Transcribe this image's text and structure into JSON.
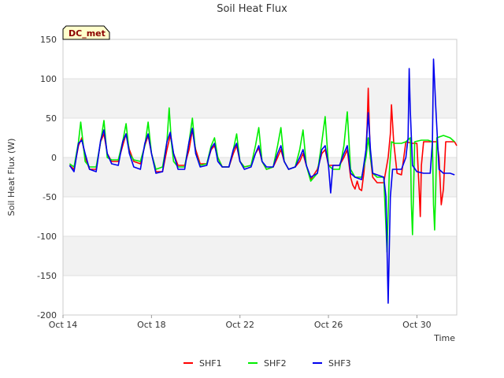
{
  "chart_data": {
    "type": "line",
    "title": "Soil Heat Flux",
    "xlabel": "Time",
    "ylabel": "Soil Heat Flux (W)",
    "badge": "DC_met",
    "xlim_days": [
      14,
      31.8
    ],
    "ylim": [
      -200,
      150
    ],
    "y_ticks": [
      -200,
      -150,
      -100,
      -50,
      0,
      50,
      100,
      150
    ],
    "x_ticks": [
      {
        "label": "Oct 14",
        "day": 14
      },
      {
        "label": "Oct 18",
        "day": 18
      },
      {
        "label": "Oct 22",
        "day": 22
      },
      {
        "label": "Oct 26",
        "day": 26
      },
      {
        "label": "Oct 30",
        "day": 30
      }
    ],
    "legend_position": "bottom-center",
    "series": [
      {
        "name": "SHF1",
        "color": "#ff0000",
        "points": [
          [
            14.3,
            -10
          ],
          [
            14.5,
            -15
          ],
          [
            14.7,
            15
          ],
          [
            14.85,
            25
          ],
          [
            15.0,
            0
          ],
          [
            15.2,
            -15
          ],
          [
            15.5,
            -15
          ],
          [
            15.7,
            20
          ],
          [
            15.85,
            30
          ],
          [
            16.0,
            5
          ],
          [
            16.2,
            -5
          ],
          [
            16.5,
            -5
          ],
          [
            16.7,
            15
          ],
          [
            16.85,
            30
          ],
          [
            17.0,
            10
          ],
          [
            17.2,
            -5
          ],
          [
            17.5,
            -8
          ],
          [
            17.7,
            15
          ],
          [
            17.85,
            28
          ],
          [
            18.0,
            5
          ],
          [
            18.2,
            -18
          ],
          [
            18.5,
            -18
          ],
          [
            18.7,
            10
          ],
          [
            18.85,
            28
          ],
          [
            19.0,
            5
          ],
          [
            19.2,
            -10
          ],
          [
            19.5,
            -10
          ],
          [
            19.7,
            10
          ],
          [
            19.85,
            35
          ],
          [
            20.0,
            10
          ],
          [
            20.2,
            -8
          ],
          [
            20.5,
            -8
          ],
          [
            20.7,
            10
          ],
          [
            20.85,
            15
          ],
          [
            21.0,
            0
          ],
          [
            21.2,
            -12
          ],
          [
            21.5,
            -12
          ],
          [
            21.7,
            5
          ],
          [
            21.85,
            15
          ],
          [
            22.0,
            -5
          ],
          [
            22.2,
            -12
          ],
          [
            22.5,
            -10
          ],
          [
            22.7,
            5
          ],
          [
            22.85,
            12
          ],
          [
            23.0,
            -5
          ],
          [
            23.2,
            -15
          ],
          [
            23.5,
            -12
          ],
          [
            23.7,
            0
          ],
          [
            23.85,
            10
          ],
          [
            24.0,
            -5
          ],
          [
            24.2,
            -15
          ],
          [
            24.5,
            -12
          ],
          [
            24.7,
            -5
          ],
          [
            24.85,
            5
          ],
          [
            25.0,
            -10
          ],
          [
            25.2,
            -28
          ],
          [
            25.5,
            -15
          ],
          [
            25.7,
            5
          ],
          [
            25.85,
            10
          ],
          [
            26.0,
            -10
          ],
          [
            26.2,
            -10
          ],
          [
            26.5,
            -10
          ],
          [
            26.7,
            0
          ],
          [
            26.85,
            10
          ],
          [
            27.0,
            -25
          ],
          [
            27.1,
            -35
          ],
          [
            27.2,
            -40
          ],
          [
            27.3,
            -30
          ],
          [
            27.4,
            -40
          ],
          [
            27.5,
            -42
          ],
          [
            27.6,
            -20
          ],
          [
            27.7,
            10
          ],
          [
            27.75,
            40
          ],
          [
            27.8,
            88
          ],
          [
            27.85,
            40
          ],
          [
            27.9,
            0
          ],
          [
            28.0,
            -25
          ],
          [
            28.2,
            -32
          ],
          [
            28.5,
            -32
          ],
          [
            28.7,
            0
          ],
          [
            28.8,
            30
          ],
          [
            28.85,
            67
          ],
          [
            28.95,
            20
          ],
          [
            29.1,
            -20
          ],
          [
            29.3,
            -22
          ],
          [
            29.5,
            20
          ],
          [
            29.8,
            18
          ],
          [
            30.0,
            18
          ],
          [
            30.1,
            -40
          ],
          [
            30.15,
            -75
          ],
          [
            30.2,
            -10
          ],
          [
            30.3,
            20
          ],
          [
            30.6,
            20
          ],
          [
            30.9,
            20
          ],
          [
            31.0,
            0
          ],
          [
            31.1,
            -60
          ],
          [
            31.2,
            -40
          ],
          [
            31.3,
            20
          ],
          [
            31.5,
            20
          ],
          [
            31.7,
            20
          ],
          [
            31.8,
            15
          ],
          [
            32.0,
            10
          ],
          [
            32.1,
            10
          ],
          [
            32.2,
            20
          ],
          [
            32.25,
            65
          ],
          [
            32.3,
            30
          ],
          [
            32.4,
            -5
          ],
          [
            32.5,
            -15
          ],
          [
            32.6,
            -10
          ]
        ]
      },
      {
        "name": "SHF2",
        "color": "#00ee00",
        "points": [
          [
            14.3,
            -8
          ],
          [
            14.5,
            -12
          ],
          [
            14.7,
            20
          ],
          [
            14.8,
            45
          ],
          [
            14.9,
            20
          ],
          [
            15.0,
            -5
          ],
          [
            15.2,
            -12
          ],
          [
            15.5,
            -12
          ],
          [
            15.7,
            20
          ],
          [
            15.85,
            47
          ],
          [
            16.0,
            0
          ],
          [
            16.2,
            -3
          ],
          [
            16.5,
            -3
          ],
          [
            16.7,
            20
          ],
          [
            16.85,
            43
          ],
          [
            17.0,
            5
          ],
          [
            17.2,
            -3
          ],
          [
            17.5,
            -5
          ],
          [
            17.7,
            15
          ],
          [
            17.85,
            45
          ],
          [
            18.0,
            5
          ],
          [
            18.2,
            -15
          ],
          [
            18.5,
            -12
          ],
          [
            18.7,
            20
          ],
          [
            18.8,
            63
          ],
          [
            18.9,
            20
          ],
          [
            19.0,
            -5
          ],
          [
            19.2,
            -12
          ],
          [
            19.5,
            -12
          ],
          [
            19.7,
            20
          ],
          [
            19.85,
            50
          ],
          [
            20.0,
            5
          ],
          [
            20.2,
            -10
          ],
          [
            20.5,
            -8
          ],
          [
            20.7,
            15
          ],
          [
            20.85,
            25
          ],
          [
            21.0,
            0
          ],
          [
            21.2,
            -12
          ],
          [
            21.5,
            -12
          ],
          [
            21.7,
            10
          ],
          [
            21.85,
            30
          ],
          [
            22.0,
            -5
          ],
          [
            22.2,
            -12
          ],
          [
            22.5,
            -10
          ],
          [
            22.7,
            15
          ],
          [
            22.85,
            38
          ],
          [
            23.0,
            -5
          ],
          [
            23.2,
            -15
          ],
          [
            23.5,
            -12
          ],
          [
            23.7,
            15
          ],
          [
            23.85,
            38
          ],
          [
            24.0,
            -5
          ],
          [
            24.2,
            -15
          ],
          [
            24.5,
            -12
          ],
          [
            24.7,
            10
          ],
          [
            24.85,
            35
          ],
          [
            25.0,
            -10
          ],
          [
            25.2,
            -30
          ],
          [
            25.5,
            -20
          ],
          [
            25.7,
            20
          ],
          [
            25.85,
            52
          ],
          [
            26.0,
            -10
          ],
          [
            26.2,
            -15
          ],
          [
            26.5,
            -15
          ],
          [
            26.7,
            15
          ],
          [
            26.85,
            58
          ],
          [
            27.0,
            -15
          ],
          [
            27.2,
            -25
          ],
          [
            27.5,
            -25
          ],
          [
            27.7,
            0
          ],
          [
            27.8,
            25
          ],
          [
            27.9,
            0
          ],
          [
            28.0,
            -20
          ],
          [
            28.2,
            -25
          ],
          [
            28.5,
            -25
          ],
          [
            28.65,
            -120
          ],
          [
            28.75,
            -20
          ],
          [
            28.85,
            20
          ],
          [
            29.0,
            18
          ],
          [
            29.3,
            18
          ],
          [
            29.5,
            20
          ],
          [
            29.7,
            25
          ],
          [
            29.75,
            -60
          ],
          [
            29.8,
            -98
          ],
          [
            29.85,
            -40
          ],
          [
            29.9,
            20
          ],
          [
            30.2,
            22
          ],
          [
            30.5,
            22
          ],
          [
            30.7,
            20
          ],
          [
            30.75,
            -60
          ],
          [
            30.8,
            -92
          ],
          [
            30.85,
            -40
          ],
          [
            30.9,
            25
          ],
          [
            31.2,
            28
          ],
          [
            31.5,
            25
          ],
          [
            31.7,
            20
          ],
          [
            31.9,
            15
          ],
          [
            32.0,
            -20
          ],
          [
            32.05,
            -65
          ],
          [
            32.1,
            -40
          ],
          [
            32.2,
            10
          ],
          [
            32.3,
            20
          ],
          [
            32.4,
            20
          ],
          [
            32.5,
            15
          ],
          [
            32.6,
            5
          ]
        ]
      },
      {
        "name": "SHF3",
        "color": "#0000ee",
        "points": [
          [
            14.3,
            -10
          ],
          [
            14.5,
            -18
          ],
          [
            14.7,
            18
          ],
          [
            14.85,
            22
          ],
          [
            15.0,
            5
          ],
          [
            15.2,
            -15
          ],
          [
            15.5,
            -18
          ],
          [
            15.7,
            22
          ],
          [
            15.85,
            35
          ],
          [
            16.0,
            5
          ],
          [
            16.2,
            -8
          ],
          [
            16.5,
            -10
          ],
          [
            16.7,
            20
          ],
          [
            16.85,
            30
          ],
          [
            17.0,
            5
          ],
          [
            17.2,
            -12
          ],
          [
            17.5,
            -15
          ],
          [
            17.7,
            18
          ],
          [
            17.85,
            30
          ],
          [
            18.0,
            5
          ],
          [
            18.2,
            -20
          ],
          [
            18.5,
            -18
          ],
          [
            18.7,
            20
          ],
          [
            18.85,
            32
          ],
          [
            19.0,
            5
          ],
          [
            19.2,
            -15
          ],
          [
            19.5,
            -15
          ],
          [
            19.7,
            20
          ],
          [
            19.85,
            37
          ],
          [
            20.0,
            5
          ],
          [
            20.2,
            -12
          ],
          [
            20.5,
            -10
          ],
          [
            20.7,
            12
          ],
          [
            20.85,
            18
          ],
          [
            21.0,
            -5
          ],
          [
            21.2,
            -12
          ],
          [
            21.5,
            -12
          ],
          [
            21.7,
            10
          ],
          [
            21.85,
            18
          ],
          [
            22.0,
            -5
          ],
          [
            22.2,
            -15
          ],
          [
            22.5,
            -12
          ],
          [
            22.7,
            5
          ],
          [
            22.85,
            15
          ],
          [
            23.0,
            -5
          ],
          [
            23.2,
            -12
          ],
          [
            23.5,
            -12
          ],
          [
            23.7,
            5
          ],
          [
            23.85,
            15
          ],
          [
            24.0,
            -5
          ],
          [
            24.2,
            -15
          ],
          [
            24.5,
            -12
          ],
          [
            24.7,
            0
          ],
          [
            24.85,
            10
          ],
          [
            25.0,
            -10
          ],
          [
            25.2,
            -25
          ],
          [
            25.5,
            -20
          ],
          [
            25.7,
            10
          ],
          [
            25.85,
            15
          ],
          [
            26.0,
            -10
          ],
          [
            26.1,
            -45
          ],
          [
            26.2,
            -10
          ],
          [
            26.5,
            -10
          ],
          [
            26.7,
            5
          ],
          [
            26.85,
            15
          ],
          [
            27.0,
            -20
          ],
          [
            27.2,
            -25
          ],
          [
            27.5,
            -28
          ],
          [
            27.7,
            10
          ],
          [
            27.8,
            57
          ],
          [
            27.9,
            10
          ],
          [
            28.0,
            -20
          ],
          [
            28.2,
            -22
          ],
          [
            28.5,
            -25
          ],
          [
            28.6,
            -50
          ],
          [
            28.7,
            -185
          ],
          [
            28.8,
            -50
          ],
          [
            28.9,
            -15
          ],
          [
            29.0,
            -15
          ],
          [
            29.3,
            -15
          ],
          [
            29.5,
            0
          ],
          [
            29.6,
            25
          ],
          [
            29.65,
            113
          ],
          [
            29.7,
            60
          ],
          [
            29.8,
            -10
          ],
          [
            30.0,
            -18
          ],
          [
            30.3,
            -20
          ],
          [
            30.6,
            -20
          ],
          [
            30.7,
            20
          ],
          [
            30.75,
            125
          ],
          [
            30.85,
            65
          ],
          [
            31.0,
            -15
          ],
          [
            31.2,
            -20
          ],
          [
            31.5,
            -20
          ],
          [
            31.7,
            -22
          ],
          [
            31.9,
            -18
          ],
          [
            32.0,
            0
          ],
          [
            32.1,
            40
          ],
          [
            32.15,
            65
          ],
          [
            32.25,
            30
          ],
          [
            32.4,
            -25
          ],
          [
            32.5,
            -20
          ],
          [
            32.6,
            -5
          ]
        ]
      }
    ]
  }
}
